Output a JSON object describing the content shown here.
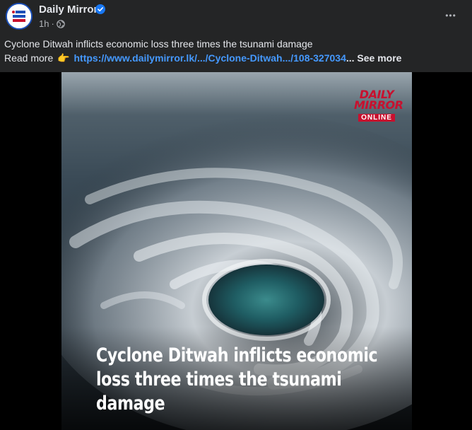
{
  "post": {
    "page_name": "Daily Mirror",
    "time": "1h",
    "separator": "·",
    "audience_icon": "globe-icon",
    "verified_icon": "verified-badge-icon",
    "menu_icon": "more-options-icon",
    "menu_glyph": "•••",
    "text_line1": "Cyclone Ditwah inflicts economic loss three times the tsunami damage",
    "read_more": "Read more",
    "pointer_emoji": "👉",
    "link_text": "https://www.dailymirror.lk/.../Cyclone-Ditwah.../108-327034",
    "see_more": "... See more"
  },
  "image": {
    "caption_line1": "Cyclone Ditwah inflicts economic",
    "caption_line2": "loss three times the tsunami",
    "caption_line3": "damage",
    "logo_line1": "DAILY",
    "logo_line2": "MIRROR",
    "logo_line3": "ONLINE"
  },
  "colors": {
    "background": "#242526",
    "link": "#4599ff",
    "brand_red": "#c8102e",
    "brand_blue": "#1b4fb8"
  }
}
